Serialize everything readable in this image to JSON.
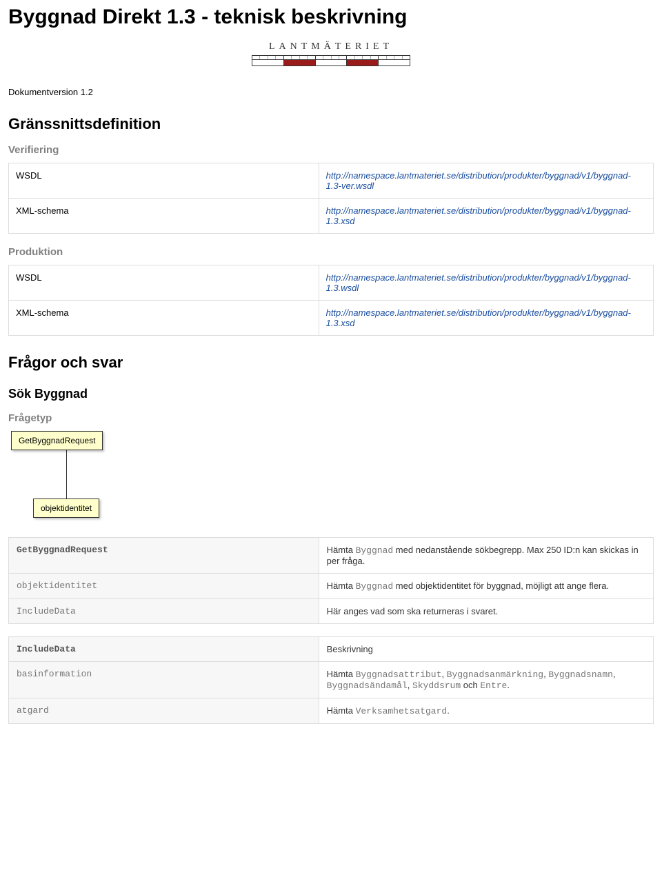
{
  "title": "Byggnad Direkt 1.3 - teknisk beskrivning",
  "logo_text": "LANTMÄTERIET",
  "doc_version": "Dokumentversion 1.2",
  "section_interface": "Gränssnittsdefinition",
  "verifiering": {
    "heading": "Verifiering",
    "rows": [
      {
        "key": "WSDL",
        "val": "http://namespace.lantmateriet.se/distribution/produkter/byggnad/v1/byggnad-1.3-ver.wsdl"
      },
      {
        "key": "XML-schema",
        "val": "http://namespace.lantmateriet.se/distribution/produkter/byggnad/v1/byggnad-1.3.xsd"
      }
    ]
  },
  "produktion": {
    "heading": "Produktion",
    "rows": [
      {
        "key": "WSDL",
        "val": "http://namespace.lantmateriet.se/distribution/produkter/byggnad/v1/byggnad-1.3.wsdl"
      },
      {
        "key": "XML-schema",
        "val": "http://namespace.lantmateriet.se/distribution/produkter/byggnad/v1/byggnad-1.3.xsd"
      }
    ]
  },
  "section_qa": "Frågor och svar",
  "section_search": "Sök Byggnad",
  "fragetyp_heading": "Frågetyp",
  "diagram": {
    "root": "GetByggnadRequest",
    "child": "objektidentitet"
  },
  "request_table": {
    "rows": [
      {
        "key": "GetByggnadRequest",
        "is_head": true,
        "val_pre": "Hämta ",
        "val_mono": "Byggnad",
        "val_post": " med nedanstående sökbegrepp. Max 250 ID:n kan skickas in per fråga."
      },
      {
        "key": "objektidentitet",
        "is_head": false,
        "val_pre": "Hämta ",
        "val_mono": "Byggnad",
        "val_post": " med objektidentitet för byggnad, möjligt att ange flera."
      },
      {
        "key": "IncludeData",
        "is_head": false,
        "val_pre": "Här anges vad som ska returneras i svaret.",
        "val_mono": "",
        "val_post": ""
      }
    ]
  },
  "include_table": {
    "rows": [
      {
        "key": "IncludeData",
        "is_head": true,
        "val_plain": "Beskrivning"
      },
      {
        "key": "basinformation",
        "is_head": false,
        "val_parts": [
          {
            "t": "Hämta ",
            "mono": false
          },
          {
            "t": "Byggnadsattribut",
            "mono": true
          },
          {
            "t": ", ",
            "mono": false
          },
          {
            "t": "Byggnadsanmärkning",
            "mono": true
          },
          {
            "t": ", ",
            "mono": false
          },
          {
            "t": "Byggnadsnamn",
            "mono": true
          },
          {
            "t": ", ",
            "mono": false
          },
          {
            "t": "Byggnadsändamål",
            "mono": true
          },
          {
            "t": ", ",
            "mono": false
          },
          {
            "t": "Skyddsrum",
            "mono": true
          },
          {
            "t": " och ",
            "mono": false
          },
          {
            "t": "Entre",
            "mono": true
          },
          {
            "t": ".",
            "mono": false
          }
        ]
      },
      {
        "key": "atgard",
        "is_head": false,
        "val_parts": [
          {
            "t": "Hämta ",
            "mono": false
          },
          {
            "t": "Verksamhetsatgard",
            "mono": true
          },
          {
            "t": ".",
            "mono": false
          }
        ]
      }
    ]
  }
}
